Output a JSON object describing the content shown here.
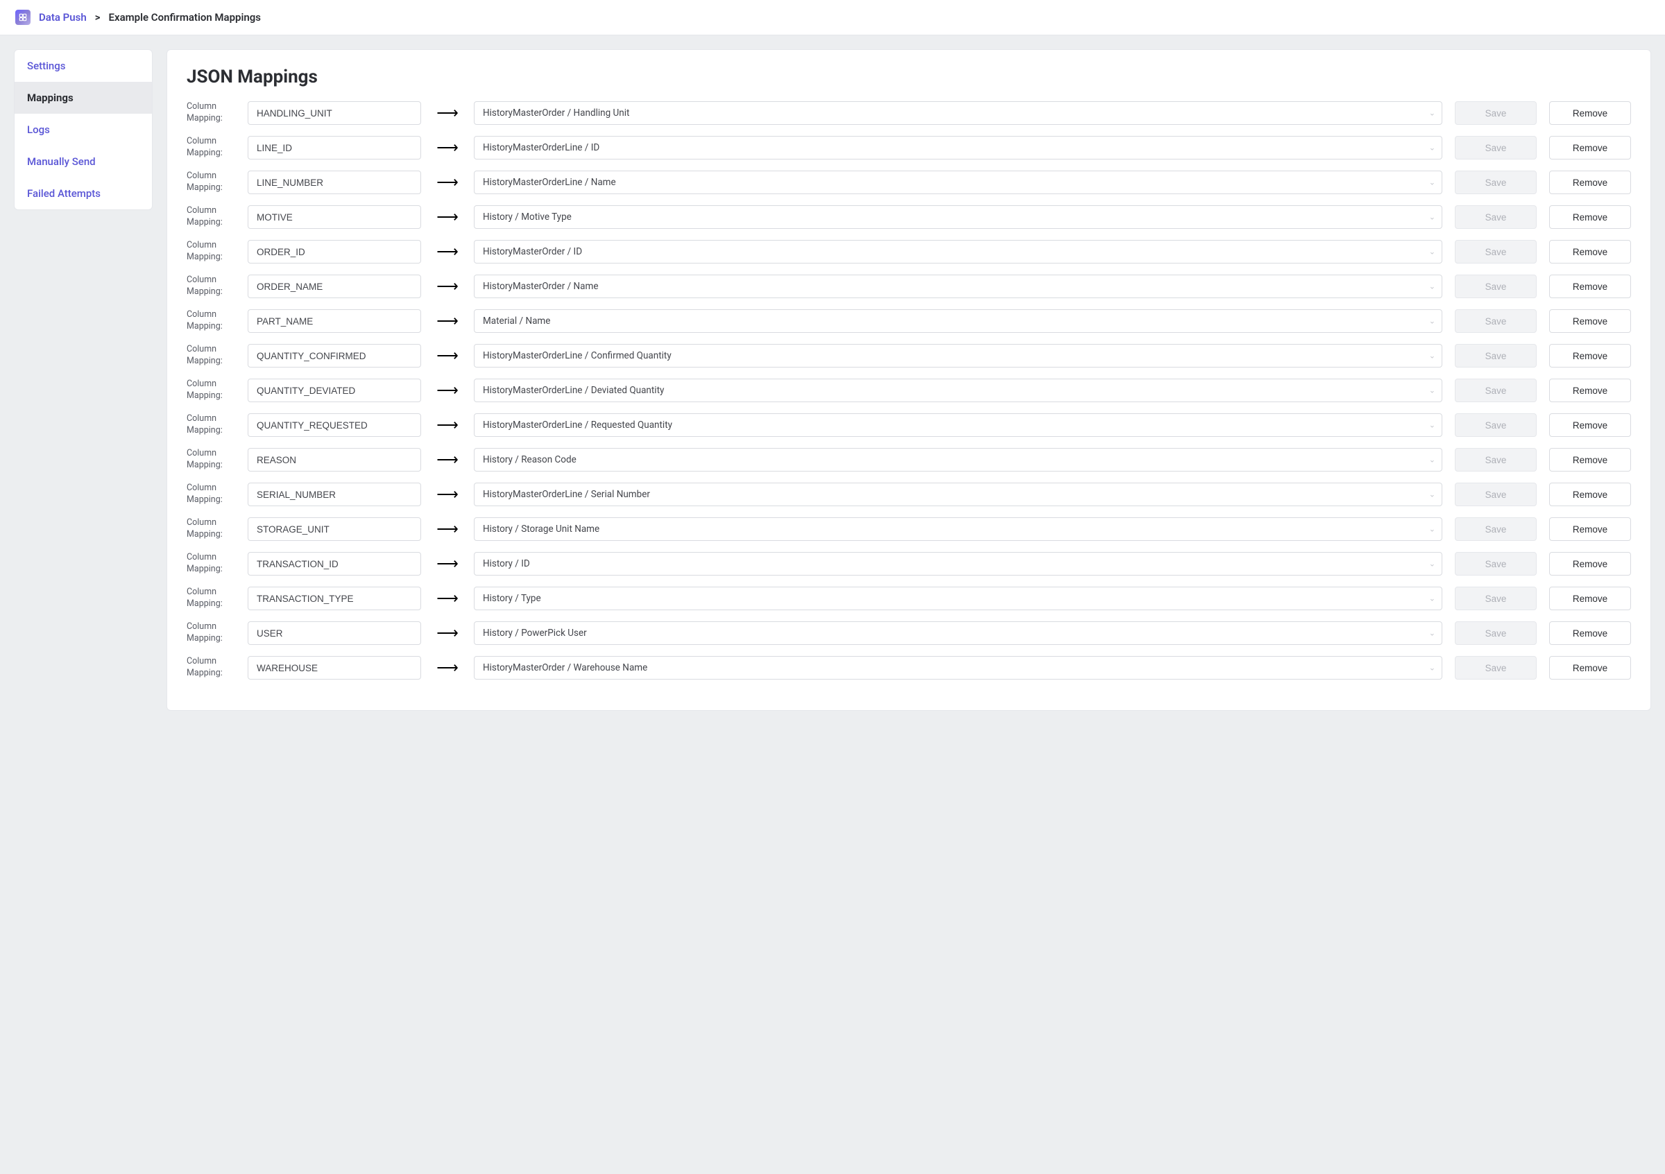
{
  "breadcrumb": {
    "root": "Data Push",
    "current": "Example Confirmation Mappings"
  },
  "sidebar": {
    "items": [
      {
        "label": "Settings",
        "active": false
      },
      {
        "label": "Mappings",
        "active": true
      },
      {
        "label": "Logs",
        "active": false
      },
      {
        "label": "Manually Send",
        "active": false
      },
      {
        "label": "Failed Attempts",
        "active": false
      }
    ]
  },
  "main": {
    "title": "JSON Mappings",
    "row_label": "Column Mapping:",
    "save_label": "Save",
    "remove_label": "Remove",
    "rows": [
      {
        "column": "HANDLING_UNIT",
        "target": "HistoryMasterOrder / Handling Unit"
      },
      {
        "column": "LINE_ID",
        "target": "HistoryMasterOrderLine / ID"
      },
      {
        "column": "LINE_NUMBER",
        "target": "HistoryMasterOrderLine / Name"
      },
      {
        "column": "MOTIVE",
        "target": "History / Motive Type"
      },
      {
        "column": "ORDER_ID",
        "target": "HistoryMasterOrder / ID"
      },
      {
        "column": "ORDER_NAME",
        "target": "HistoryMasterOrder / Name"
      },
      {
        "column": "PART_NAME",
        "target": "Material / Name"
      },
      {
        "column": "QUANTITY_CONFIRMED",
        "target": "HistoryMasterOrderLine / Confirmed Quantity"
      },
      {
        "column": "QUANTITY_DEVIATED",
        "target": "HistoryMasterOrderLine / Deviated Quantity"
      },
      {
        "column": "QUANTITY_REQUESTED",
        "target": "HistoryMasterOrderLine / Requested Quantity"
      },
      {
        "column": "REASON",
        "target": "History / Reason Code"
      },
      {
        "column": "SERIAL_NUMBER",
        "target": "HistoryMasterOrderLine / Serial Number"
      },
      {
        "column": "STORAGE_UNIT",
        "target": "History / Storage Unit Name"
      },
      {
        "column": "TRANSACTION_ID",
        "target": "History / ID"
      },
      {
        "column": "TRANSACTION_TYPE",
        "target": "History / Type"
      },
      {
        "column": "USER",
        "target": "History / PowerPick User"
      },
      {
        "column": "WAREHOUSE",
        "target": "HistoryMasterOrder / Warehouse Name"
      }
    ]
  }
}
